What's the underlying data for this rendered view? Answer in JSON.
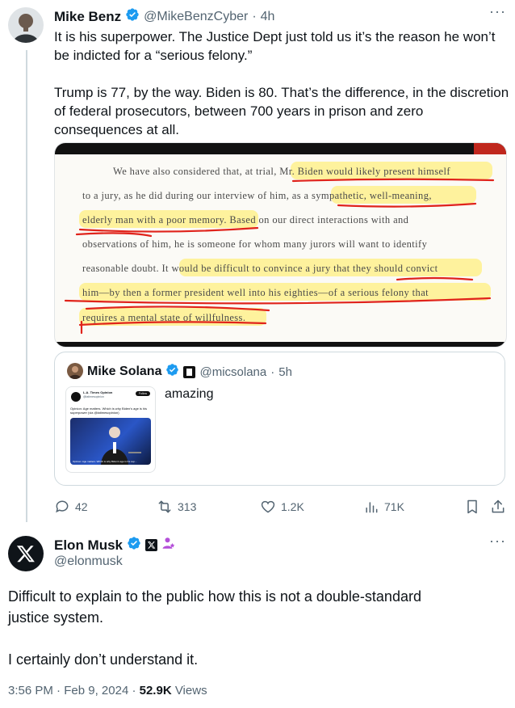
{
  "tweet1": {
    "name": "Mike Benz",
    "handle": "@MikeBenzCyber",
    "time": "4h",
    "text_lines": [
      "It is his superpower. The Justice Dept just told us it’s the reason he won’t",
      "be indicted for a “serious felony.”",
      "",
      "Trump is 77, by the way. Biden is 80. That’s the difference, in the discretion",
      "of federal prosecutors, between 700 years in prison and zero",
      "consequences at all."
    ],
    "document": {
      "lines": [
        "We have also considered that, at trial, Mr. Biden would likely present himself",
        "to a jury, as he did during our interview of him, as a sympathetic, well-meaning,",
        "elderly man with a poor memory. Based on our direct interactions with and",
        "observations of him, he is someone for whom many jurors will want to identify",
        "reasonable doubt. It would be difficult to convince a jury that they should convict",
        "him—by then a former president well into his eighties—of a serious felony that",
        "requires a mental state of willfulness."
      ]
    },
    "quote": {
      "name": "Mike Solana",
      "handle": "@micsolana",
      "time": "5h",
      "text": "amazing",
      "thumb": {
        "source": "L.A. Times Opinion",
        "source_handle": "@latimesopinion",
        "follow": "Follow",
        "headline": "Opinion: Age matters. Which is why Biden's age is his superpower (via @latimesopinion)",
        "caption": "Opinion: Age matters. Which is why Biden's age is his sup..."
      }
    },
    "actions": {
      "replies": "42",
      "reposts": "313",
      "likes": "1.2K",
      "views": "71K"
    }
  },
  "tweet2": {
    "name": "Elon Musk",
    "handle": "@elonmusk",
    "text_lines": [
      "Difficult to explain to the public how this is not a double-standard",
      "justice system.",
      "",
      "I certainly don’t understand it."
    ],
    "time": "3:56 PM",
    "date": "Feb 9, 2024",
    "views_count": "52.9K",
    "views_label": "Views"
  },
  "colors": {
    "verified": "#1d9bf0",
    "highlight": "#fff176",
    "underline": "#e0231b"
  }
}
